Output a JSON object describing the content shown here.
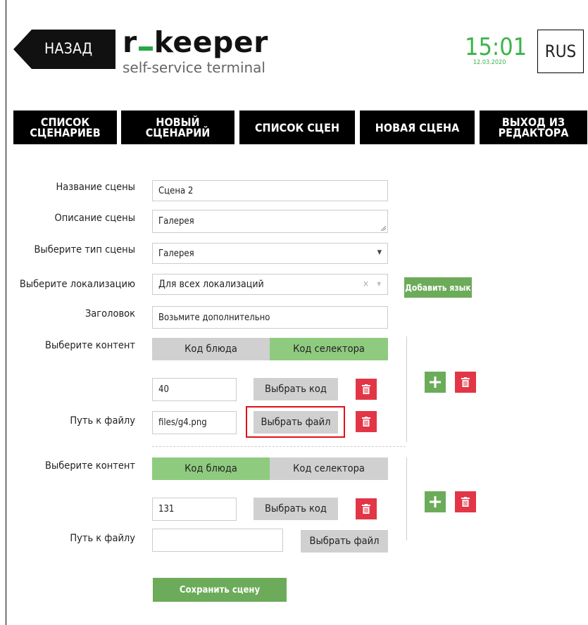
{
  "header": {
    "back_label": "НАЗАД",
    "brand_left": "r",
    "brand_right": "keeper",
    "subtitle": "self-service terminal",
    "time": "15:01",
    "date": "12.03.2020",
    "lang": "RUS"
  },
  "nav": {
    "scenario_list": [
      "СПИСОК",
      "СЦЕНАРИЕВ"
    ],
    "new_scenario": [
      "НОВЫЙ",
      "СЦЕНАРИЙ"
    ],
    "scene_list": "СПИСОК СЦЕН",
    "new_scene": "НОВАЯ СЦЕНА",
    "exit_editor": [
      "ВЫХОД ИЗ",
      "РЕДАКТОРА"
    ]
  },
  "form": {
    "scene_name_label": "Название сцены",
    "scene_name_value": "Сцена 2",
    "scene_desc_label": "Описание сцены",
    "scene_desc_value": "Галерея",
    "scene_type_label": "Выберите тип сцены",
    "scene_type_value": "Галерея",
    "locale_label": "Выберите локализацию",
    "locale_value": "Для всех локализаций",
    "add_lang_button": "Добавить язык",
    "header_label": "Заголовок",
    "header_value": "Возьмите дополнительно",
    "blocks": [
      {
        "content_label": "Выберите контент",
        "seg_dish": "Код блюда",
        "seg_selector": "Код селектора",
        "active": "selector",
        "code_value": "40",
        "pick_code_button": "Выбрать код",
        "path_label": "Путь к файлу",
        "path_value": "files/g4.png",
        "pick_file_button": "Выбрать файл"
      },
      {
        "content_label": "Выберите контент",
        "seg_dish": "Код блюда",
        "seg_selector": "Код селектора",
        "active": "dish",
        "code_value": "131",
        "pick_code_button": "Выбрать код",
        "path_label": "Путь к файлу",
        "path_value": "",
        "pick_file_button": "Выбрать файл"
      }
    ],
    "save_button": "Сохранить сцену"
  },
  "colors": {
    "accent_green": "#6cab5a",
    "active_segment": "#8fcb7f",
    "delete_red": "#e23646",
    "clock_green": "#3ab449",
    "highlight_red": "#e0101a"
  },
  "icons": [
    "back-arrow-icon",
    "trash-icon",
    "plus-icon",
    "chevron-down-icon",
    "clear-x-icon",
    "resize-handle-icon"
  ]
}
